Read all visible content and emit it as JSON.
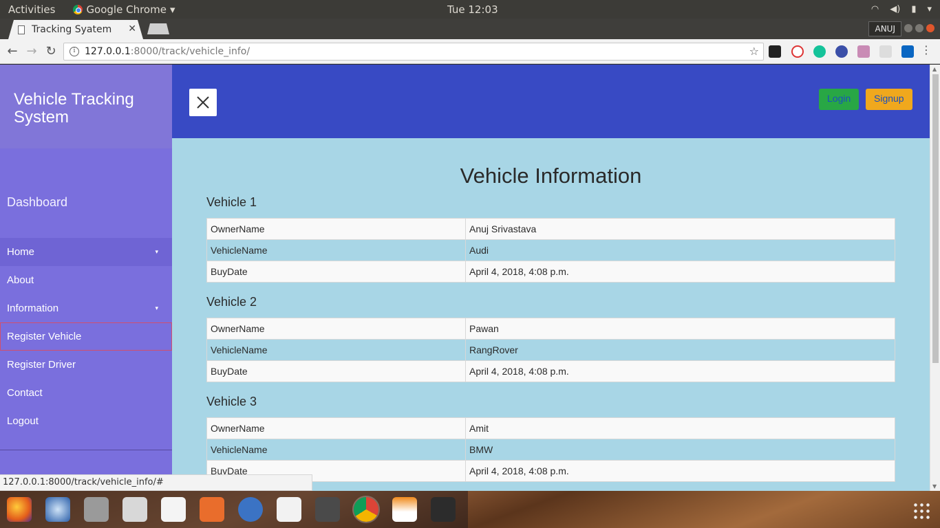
{
  "system_bar": {
    "activities": "Activities",
    "app_name": "Google Chrome",
    "clock": "Tue 12:03"
  },
  "browser": {
    "tab_title": "Tracking Syatem",
    "profile": "ANUJ",
    "url_host": "127.0.0.1",
    "url_path": ":8000/track/vehicle_info/",
    "status_url": "127.0.0.1:8000/track/vehicle_info/#"
  },
  "sidebar": {
    "brand": "Vehicle Tracking System",
    "dashboard": "Dashboard",
    "items": [
      {
        "label": "Home",
        "caret": "▾"
      },
      {
        "label": "About"
      },
      {
        "label": "Information",
        "caret": "▾"
      },
      {
        "label": "Register Vehicle"
      },
      {
        "label": "Register Driver"
      },
      {
        "label": "Contact"
      },
      {
        "label": "Logout"
      }
    ]
  },
  "header": {
    "login_label": "Login",
    "signup_label": "Signup"
  },
  "main": {
    "title": "Vehicle Information",
    "vehicles": [
      {
        "heading": "Vehicle 1",
        "rows": [
          [
            "OwnerName",
            "Anuj Srivastava"
          ],
          [
            "VehicleName",
            "Audi"
          ],
          [
            "BuyDate",
            "April 4, 2018, 4:08 p.m."
          ]
        ]
      },
      {
        "heading": "Vehicle 2",
        "rows": [
          [
            "OwnerName",
            "Pawan"
          ],
          [
            "VehicleName",
            "RangRover"
          ],
          [
            "BuyDate",
            "April 4, 2018, 4:08 p.m."
          ]
        ]
      },
      {
        "heading": "Vehicle 3",
        "rows": [
          [
            "OwnerName",
            "Amit"
          ],
          [
            "VehicleName",
            "BMW"
          ],
          [
            "BuyDate",
            "April 4, 2018, 4:08 p.m."
          ]
        ]
      }
    ]
  },
  "colors": {
    "sidebar": "#7a6fdd",
    "header": "#384ac4",
    "content_bg": "#a8d6e6",
    "login": "#28a745",
    "signup": "#f0a81d"
  }
}
